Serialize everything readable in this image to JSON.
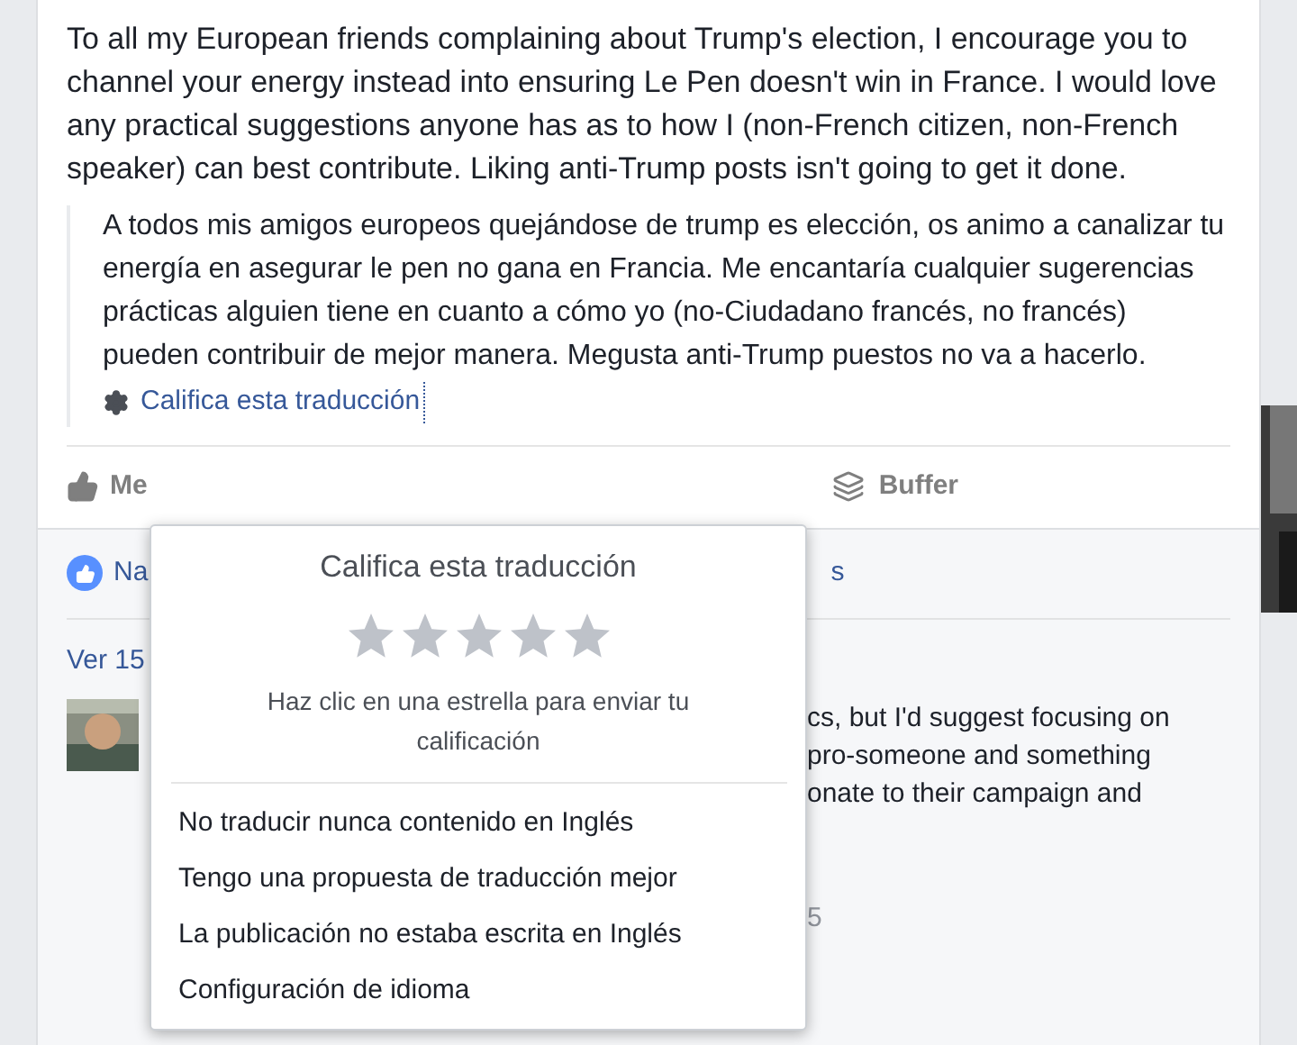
{
  "post": {
    "text": "To all my European friends complaining about Trump's election, I encourage you to channel your energy instead into ensuring Le Pen doesn't win in France. I would love any practical suggestions anyone has as to how I (non-French citizen, non-French speaker) can best contribute. Liking anti-Trump posts isn't going to get it done.",
    "translation": "A todos mis amigos europeos quejándose de trump es elección, os animo a canalizar tu energía en asegurar le pen no gana en Francia. Me encantaría cualquier sugerencias prácticas alguien tiene en cuanto a cómo yo (no-Ciudadano francés, no francés) pueden contribuir de mejor manera. Megusta anti-Trump puestos no va a hacerlo.",
    "rate_link": "Califica esta traducción"
  },
  "actions": [
    {
      "label": "Me"
    },
    {
      "label": "Buffer"
    }
  ],
  "reactions": {
    "left": "Na",
    "right": "s"
  },
  "comments": {
    "more": "Ver 15",
    "lines": [
      "cs, but I'd suggest focusing on",
      "pro-someone and something",
      "onate to their campaign and"
    ],
    "meta": "5"
  },
  "popup": {
    "title": "Califica esta traducción",
    "stars": 0,
    "hint": "Haz clic en una estrella para enviar tu calificación",
    "items": [
      "No traducir nunca contenido en Inglés",
      "Tengo una propuesta de traducción mejor",
      "La publicación no estaba escrita en Inglés",
      "Configuración de idioma"
    ]
  }
}
